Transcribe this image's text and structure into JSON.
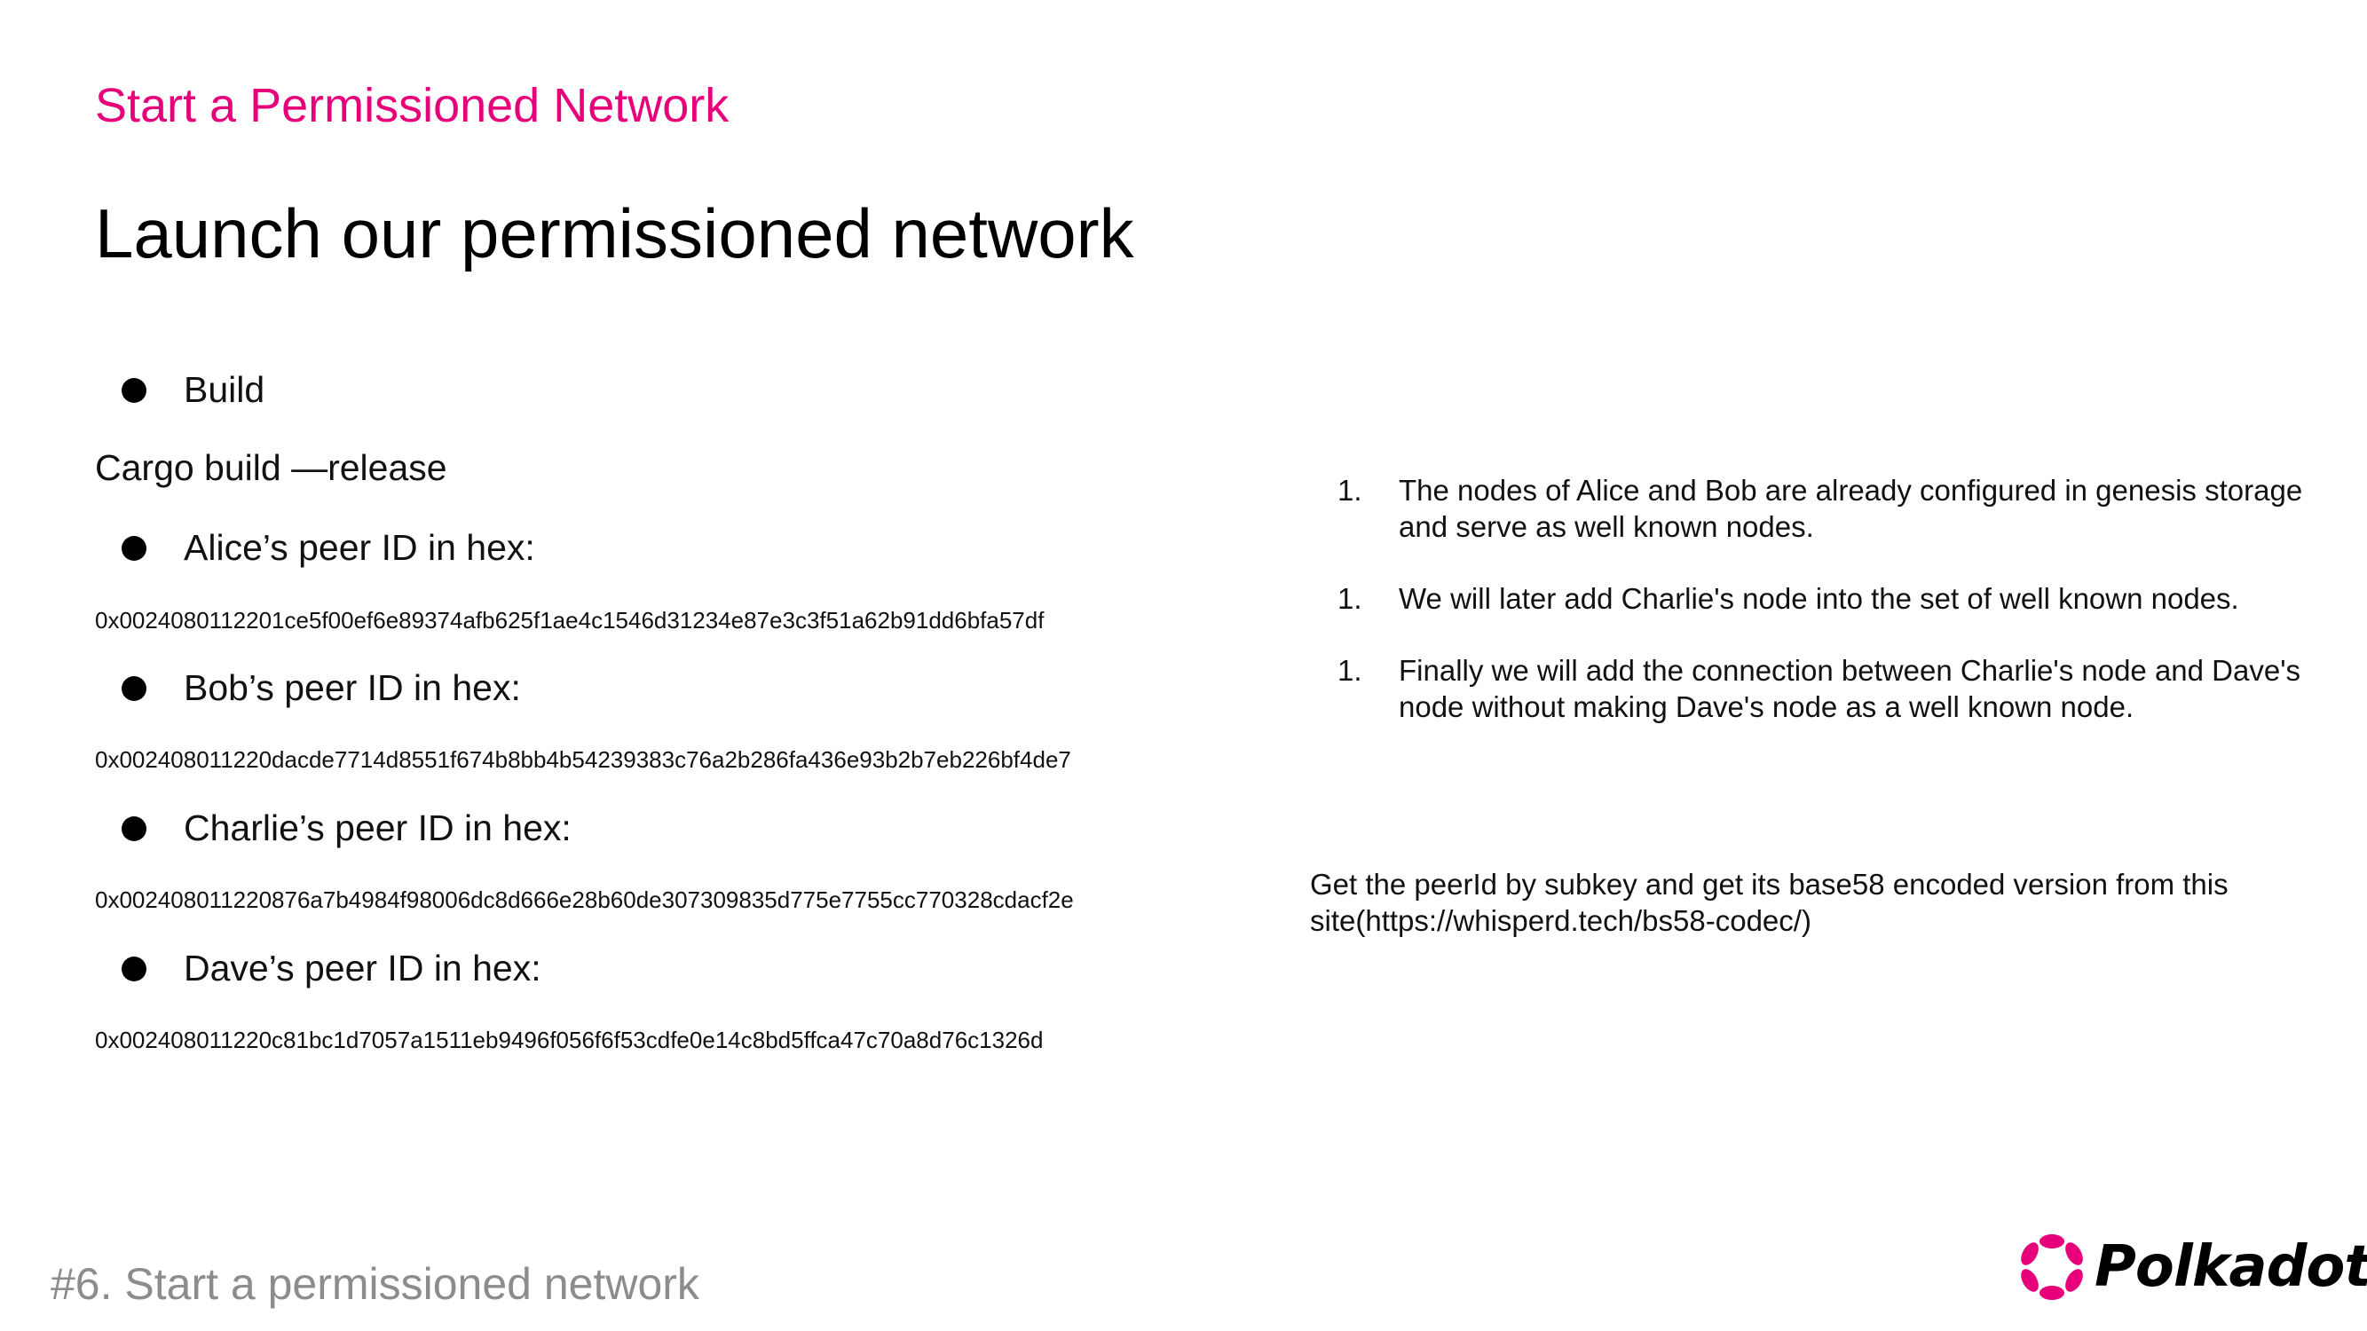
{
  "slide": {
    "section_label": "Start a Permissioned Network",
    "title": "Launch our permissioned network"
  },
  "left_column": {
    "build_label": "Build",
    "build_command": "Cargo build —release",
    "peers": [
      {
        "label": "Alice’s peer ID in hex:",
        "hex": "0x0024080112201ce5f00ef6e89374afb625f1ae4c1546d31234e87e3c3f51a62b91dd6bfa57df"
      },
      {
        "label": "Bob’s peer ID in hex:",
        "hex": "0x002408011220dacde7714d8551f674b8bb4b54239383c76a2b286fa436e93b2b7eb226bf4de7"
      },
      {
        "label": "Charlie’s peer ID in hex:",
        "hex": "0x002408011220876a7b4984f98006dc8d666e28b60de307309835d775e7755cc770328cdacf2e"
      },
      {
        "label": "Dave’s peer ID in hex:",
        "hex": "0x002408011220c81bc1d7057a1511eb9496f056f6f53cdfe0e14c8bd5ffca47c70a8d76c1326d"
      }
    ]
  },
  "right_column": {
    "items": [
      {
        "marker": "1.",
        "text": "The nodes of Alice and Bob are already configured in genesis storage and serve as well known nodes."
      },
      {
        "marker": "1.",
        "text": "We will later add Charlie's node into the set of well known nodes."
      },
      {
        "marker": "1.",
        "text": "Finally we will add the connection between Charlie's node and Dave's node without making Dave's node as a well known node."
      }
    ],
    "note": "Get the peerId by subkey and get its base58 encoded version from this site(https://whisperd.tech/bs58-codec/)"
  },
  "footer": {
    "label": "#6. Start a permissioned network",
    "logo_text": "Polkadot",
    "logo_icon": "polkadot-logo-icon",
    "accent_color": "#e6007a"
  }
}
